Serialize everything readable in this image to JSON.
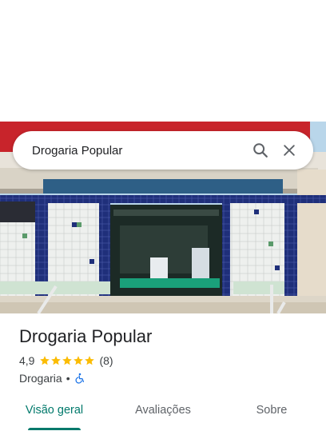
{
  "search": {
    "query": "Drogaria Popular"
  },
  "place": {
    "name": "Drogaria Popular",
    "rating": "4,9",
    "stars": 5,
    "review_count": "(8)",
    "category": "Drogaria",
    "separator": "•",
    "accessibility_icon": "wheelchair-icon"
  },
  "tabs": [
    {
      "label": "Visão geral",
      "active": true
    },
    {
      "label": "Avaliações",
      "active": false
    },
    {
      "label": "Sobre",
      "active": false
    }
  ],
  "colors": {
    "accent": "#00796b",
    "star": "#fbbc04",
    "accessibility": "#1a73e8"
  }
}
